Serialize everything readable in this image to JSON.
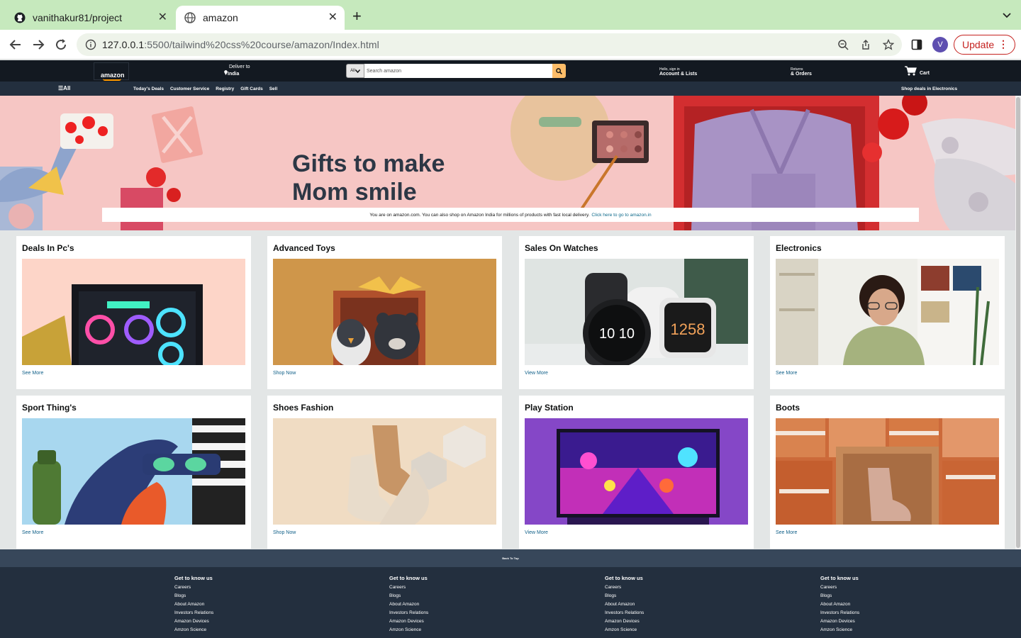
{
  "browser": {
    "tabs": [
      {
        "title": "vanithakur81/project",
        "icon": "github-icon"
      },
      {
        "title": "amazon",
        "icon": "globe-icon",
        "active": true
      }
    ],
    "url_host": "127.0.0.1",
    "url_rest": ":5500/tailwind%20css%20course/amazon/Index.html",
    "profile_initial": "V",
    "update_label": "Update"
  },
  "header": {
    "logo_text": "amazon",
    "deliver_line1": "Deliver to",
    "deliver_line2": "India",
    "search_category": "All",
    "search_placeholder": "Search amazon",
    "account_line1": "Hello, sign in",
    "account_line2": "Account & Lists",
    "returns_line1": "Returns",
    "returns_line2": "& Orders",
    "cart_label": "Cart"
  },
  "subnav": {
    "all_label": "All",
    "links": [
      "Today's Deals",
      "Customer Service",
      "Registry",
      "Gift Cards",
      "Sell"
    ],
    "promo": "Shop deals in Electronics"
  },
  "hero": {
    "headline_line1": "Gifts to make",
    "headline_line2": "Mom smile",
    "notice_text": "You are on amazon.com. You can also shop on Amazon India for millions of products with fast local delivery.",
    "notice_link": "Click here to go to amazon.in"
  },
  "cards": [
    {
      "title": "Deals In Pc's",
      "link": "See More"
    },
    {
      "title": "Advanced Toys",
      "link": "Shop Now"
    },
    {
      "title": "Sales On Watches",
      "link": "View More"
    },
    {
      "title": "Electronics",
      "link": "See More"
    },
    {
      "title": "Sport Thing's",
      "link": "See More"
    },
    {
      "title": "Shoes Fashion",
      "link": "Shop Now"
    },
    {
      "title": "Play Station",
      "link": "View More"
    },
    {
      "title": "Boots",
      "link": "See More"
    }
  ],
  "watch_faces": {
    "left": "10 10",
    "right": "1258"
  },
  "footer": {
    "back_to_top": "Back To Top",
    "columns": [
      {
        "heading": "Get to know us",
        "links": [
          "Careers",
          "Blogs",
          "About Amazon",
          "Investors Relations",
          "Amazon Devices",
          "Amzon Science"
        ]
      },
      {
        "heading": "Get to know us",
        "links": [
          "Careers",
          "Blogs",
          "About Amazon",
          "Investors Relations",
          "Amazon Devices",
          "Amzon Science"
        ]
      },
      {
        "heading": "Get to know us",
        "links": [
          "Careers",
          "Blogs",
          "About Amazon",
          "Investors Relations",
          "Amazon Devices",
          "Amzon Science"
        ]
      },
      {
        "heading": "Get to know us",
        "links": [
          "Careers",
          "Blogs",
          "About Amazon",
          "Investors Relations",
          "Amazon Devices",
          "Amzon Science"
        ]
      }
    ]
  },
  "colors": {
    "nav_dark": "#131921",
    "nav_sub": "#232f3e",
    "accent_orange": "#febd69",
    "tab_strip": "#c6e9bd",
    "link_blue": "#0f5f88"
  }
}
